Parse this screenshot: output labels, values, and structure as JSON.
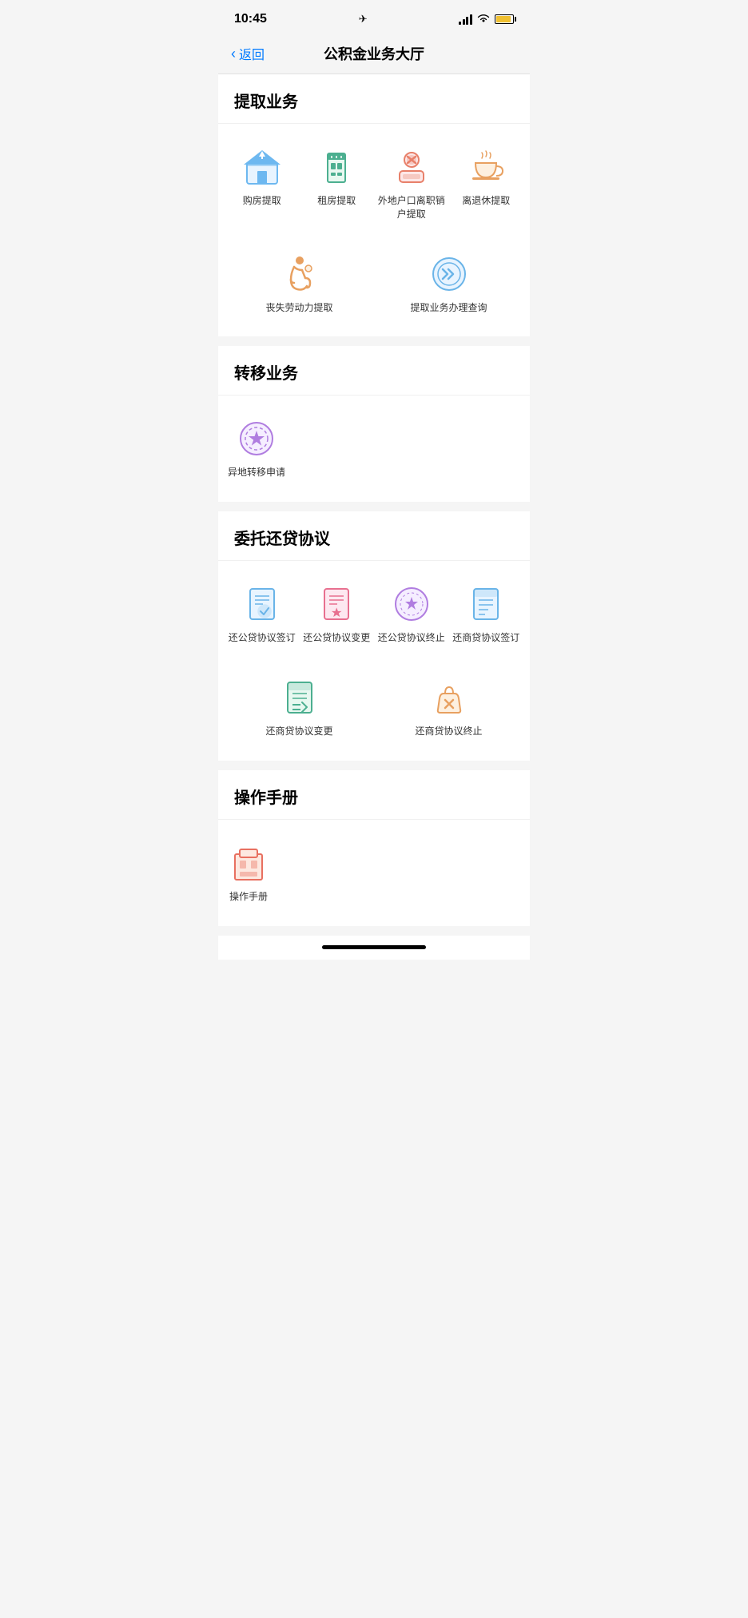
{
  "statusBar": {
    "time": "10:45",
    "hasLocation": true
  },
  "navBar": {
    "backLabel": "返回",
    "title": "公积金业务大厅"
  },
  "sections": [
    {
      "id": "withdraw",
      "title": "提取业务",
      "items": [
        {
          "id": "buy-house",
          "label": "购房提取",
          "iconType": "house-up",
          "color": "#6db8f0"
        },
        {
          "id": "rent-house",
          "label": "租房提取",
          "iconType": "trash-green",
          "color": "#4caf90"
        },
        {
          "id": "out-account",
          "label": "外地户口离职销户提取",
          "iconType": "person-cancel",
          "color": "#e8806a"
        },
        {
          "id": "retire",
          "label": "离退休提取",
          "iconType": "teacup",
          "color": "#e8a060"
        },
        {
          "id": "disability",
          "label": "丧失劳动力提取",
          "iconType": "disability",
          "color": "#e8a060"
        },
        {
          "id": "query",
          "label": "提取业务办理查询",
          "iconType": "double-arrow",
          "color": "#6ab4e8"
        }
      ],
      "layout": "mixed"
    },
    {
      "id": "transfer",
      "title": "转移业务",
      "items": [
        {
          "id": "other-city",
          "label": "异地转移申请",
          "iconType": "star-circle",
          "color": "#b07de0"
        }
      ],
      "layout": "single"
    },
    {
      "id": "loan",
      "title": "委托还贷协议",
      "items": [
        {
          "id": "pub-sign",
          "label": "还公贷协议签订",
          "iconType": "clipboard-list",
          "color": "#6ab4e8"
        },
        {
          "id": "pub-change",
          "label": "还公贷协议变更",
          "iconType": "clipboard-star",
          "color": "#e87090"
        },
        {
          "id": "pub-stop",
          "label": "还公贷协议终止",
          "iconType": "badge-star",
          "color": "#b07de0"
        },
        {
          "id": "com-sign",
          "label": "还商贷协议签订",
          "iconType": "clipboard-list2",
          "color": "#6ab4e8"
        },
        {
          "id": "com-change",
          "label": "还商贷协议变更",
          "iconType": "clipboard-check",
          "color": "#4caf90"
        },
        {
          "id": "com-stop",
          "label": "还商贷协议终止",
          "iconType": "bag-x",
          "color": "#e8a060"
        }
      ],
      "layout": "grid4"
    },
    {
      "id": "manual",
      "title": "操作手册",
      "items": [
        {
          "id": "manual-item",
          "label": "操作手册",
          "iconType": "building",
          "color": "#e87060"
        }
      ],
      "layout": "single"
    }
  ]
}
